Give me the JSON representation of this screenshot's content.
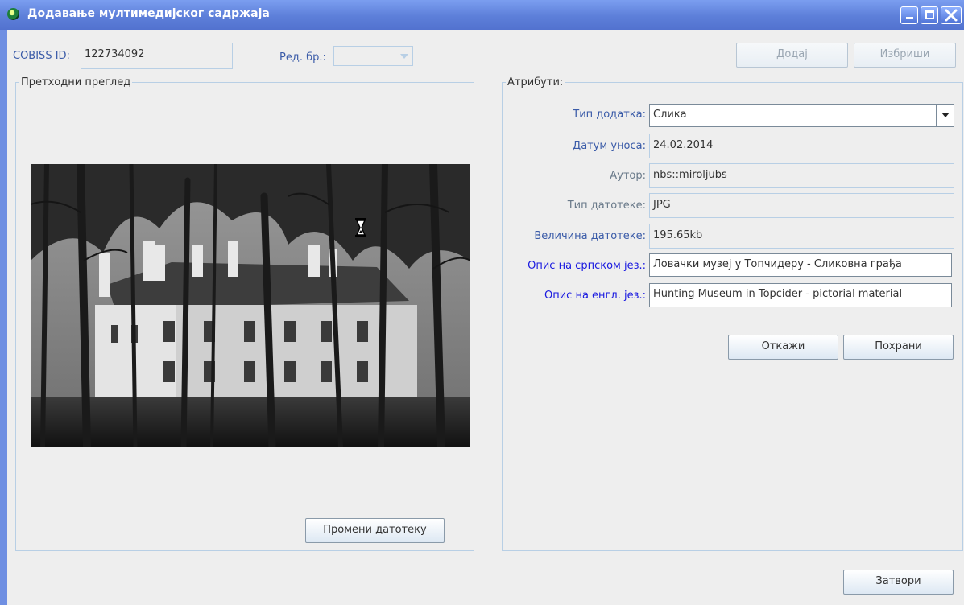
{
  "window": {
    "title": "Додавање мултимедијског садржаја",
    "controls": [
      "minimize-icon",
      "maximize-icon",
      "close-icon"
    ]
  },
  "top": {
    "cobiss_label": "COBISS ID:",
    "cobiss_value": "122734092",
    "red_br_label": "Ред. бр.:",
    "red_br_value": "",
    "add_button": "Додај",
    "delete_button": "Избриши"
  },
  "preview": {
    "legend": "Претходни преглед",
    "change_file_button": "Промени датотеку"
  },
  "attributes": {
    "legend": "Атрибути:",
    "type_label": "Тип додатка:",
    "type_value": "Слика",
    "date_label": "Датум уноса:",
    "date_value": "24.02.2014",
    "author_label": "Аутор:",
    "author_value": "nbs::miroljubs",
    "filetype_label": "Тип датотеке:",
    "filetype_value": "JPG",
    "filesize_label": "Величина датотеке:",
    "filesize_value": "195.65kb",
    "desc_sr_label": "Опис на српском јез.:",
    "desc_sr_value": "Ловачки музеј у Топчидеру - Сликовна грађа",
    "desc_en_label": "Опис на енгл. јез.:",
    "desc_en_value": "Hunting Museum in Topcider - pictorial material",
    "cancel_button": "Откажи",
    "save_button": "Похрани"
  },
  "footer": {
    "close_button": "Затвори"
  },
  "colors": {
    "titlebar": "#5d7fd9",
    "window_bg": "#eeeeee",
    "field_border": "#b8cfe5",
    "label_blue": "#3a5ba8",
    "label_bright_blue": "#1a1ae0"
  }
}
